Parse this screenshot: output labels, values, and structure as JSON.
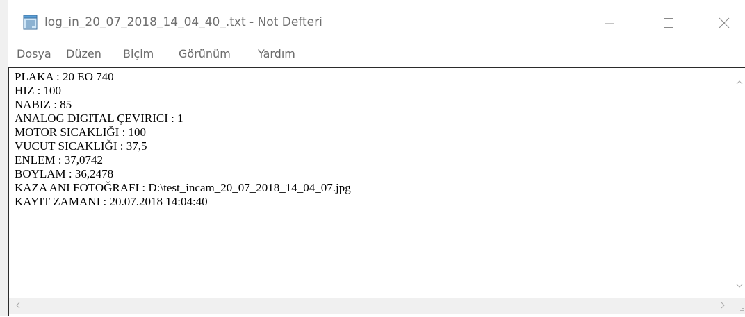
{
  "window": {
    "title": "log_in_20_07_2018_14_04_40_.txt - Not Defteri"
  },
  "menu": {
    "items": [
      "Dosya",
      "Düzen",
      "Biçim",
      "Görünüm",
      "Yardım"
    ]
  },
  "document": {
    "lines": [
      "PLAKA : 20 EO 740",
      "HIZ : 100",
      "NABIZ : 85",
      "ANALOG DIGITAL ÇEVIRICI : 1",
      "MOTOR SICAKLIĞI : 100",
      "VUCUT SICAKLIĞI : 37,5",
      "ENLEM : 37,0742",
      "BOYLAM : 36,2478",
      "KAZA ANI FOTOĞRAFI : D:\\test_incam_20_07_2018_14_04_07.jpg",
      "KAYIT ZAMANI : 20.07.2018 14:04:40"
    ]
  },
  "icons": {
    "app": "notepad-icon",
    "minimize": "minimize-icon",
    "maximize": "maximize-icon",
    "close": "close-icon"
  },
  "colors": {
    "title_text": "#6f6f6f",
    "menu_text": "#6b6b6b",
    "scrollbar_track": "#f0f0f0"
  }
}
